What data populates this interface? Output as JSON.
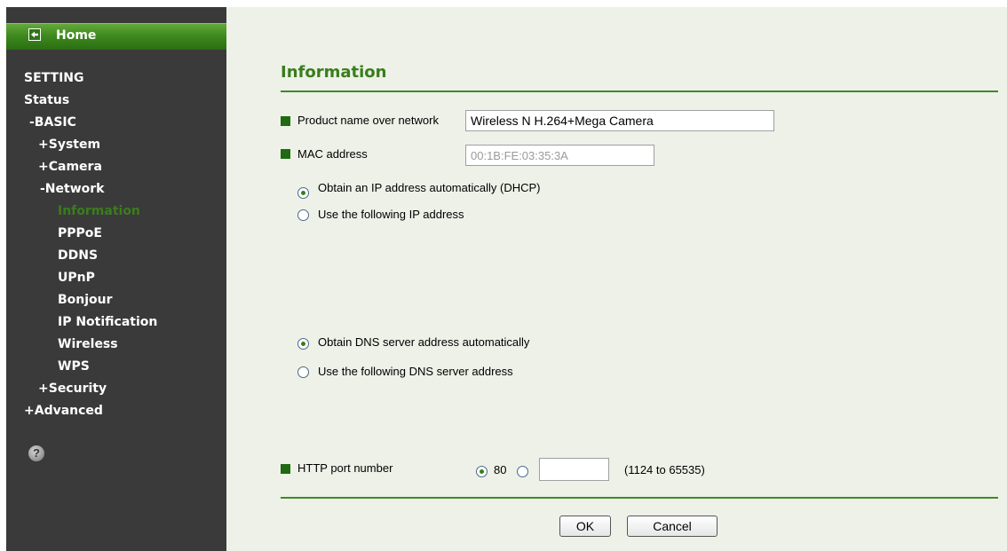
{
  "sidebar": {
    "home_label": "Home",
    "items": [
      {
        "label": "SETTING"
      },
      {
        "label": "Status"
      },
      {
        "label": "-BASIC"
      },
      {
        "label": "+System"
      },
      {
        "label": "+Camera"
      },
      {
        "label": "-Network"
      },
      {
        "label": "Information"
      },
      {
        "label": "PPPoE"
      },
      {
        "label": "DDNS"
      },
      {
        "label": "UPnP"
      },
      {
        "label": "Bonjour"
      },
      {
        "label": "IP Notification"
      },
      {
        "label": "Wireless"
      },
      {
        "label": "WPS"
      },
      {
        "label": "+Security"
      },
      {
        "label": "+Advanced"
      }
    ],
    "help_glyph": "?"
  },
  "page": {
    "title": "Information",
    "product_name": {
      "label": "Product name over network",
      "value": "Wireless N H.264+Mega Camera"
    },
    "mac": {
      "label": "MAC address",
      "value": "00:1B:FE:03:35:3A"
    },
    "ip_options": {
      "dhcp": {
        "label": "Obtain an IP address automatically (DHCP)",
        "checked": true
      },
      "static": {
        "label": "Use the following IP address",
        "checked": false
      }
    },
    "dns_options": {
      "auto": {
        "label": "Obtain DNS server address automatically",
        "checked": true
      },
      "manual": {
        "label": "Use the following DNS server address",
        "checked": false
      }
    },
    "http_port": {
      "label": "HTTP port number",
      "default_option": "80",
      "custom_value": "",
      "range": "(1124 to 65535)"
    },
    "buttons": {
      "ok": "OK",
      "cancel": "Cancel"
    }
  },
  "colors": {
    "accent": "#3a7d1c",
    "sidebar_bg": "#3a3a3a",
    "content_bg": "#edf1e8",
    "bullet": "#1f6a12"
  }
}
